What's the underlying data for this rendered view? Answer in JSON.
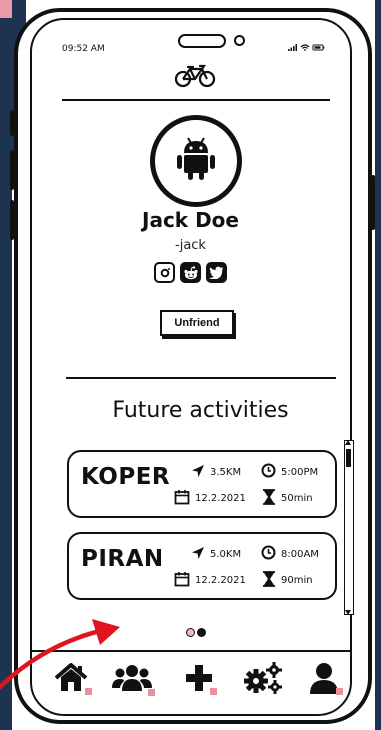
{
  "status_bar": {
    "time": "09:52 AM",
    "icons": "signal wifi battery"
  },
  "app": {
    "logo_icon": "bicycle-icon"
  },
  "profile": {
    "avatar_icon": "android-icon",
    "name": "Jack Doe",
    "handle": "-jack",
    "socials": [
      "instagram-icon",
      "reddit-icon",
      "twitter-icon"
    ],
    "unfriend_label": "Unfriend"
  },
  "activities": {
    "title": "Future activities",
    "items": [
      {
        "city": "KOPER",
        "distance": "3.5KM",
        "time": "5:00PM",
        "date": "12.2.2021",
        "duration": "50min"
      },
      {
        "city": "PIRAN",
        "distance": "5.0KM",
        "time": "8:00AM",
        "date": "12.2.2021",
        "duration": "90min"
      }
    ]
  },
  "pagination": {
    "count": 2,
    "active_index": 1
  },
  "nav": {
    "items": [
      "home-icon",
      "friends-icon",
      "add-icon",
      "settings-icon",
      "profile-icon"
    ],
    "accent_color": "#e8909e"
  },
  "colors": {
    "ink": "#111111",
    "frame_bg": "#1e3350",
    "annotation_arrow": "#e0141e"
  }
}
